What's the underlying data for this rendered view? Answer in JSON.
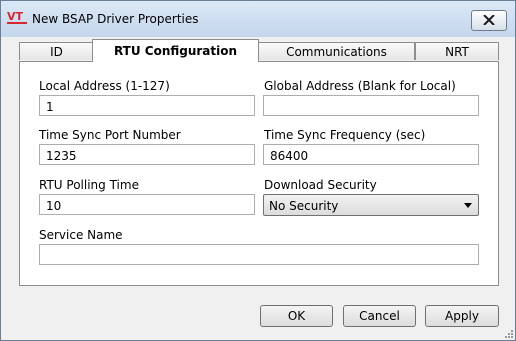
{
  "window": {
    "title": "New BSAP Driver Properties",
    "icon": "vt-logo-icon",
    "close_icon": "close-icon"
  },
  "tabs": [
    {
      "label": "ID",
      "active": false
    },
    {
      "label": "RTU Configuration",
      "active": true
    },
    {
      "label": "Communications",
      "active": false
    },
    {
      "label": "NRT",
      "active": false
    }
  ],
  "form": {
    "local_address": {
      "label": "Local Address (1-127)",
      "value": "1"
    },
    "global_address": {
      "label": "Global Address (Blank for Local)",
      "value": ""
    },
    "time_sync_port": {
      "label": "Time Sync Port Number",
      "value": "1235"
    },
    "time_sync_frequency": {
      "label": "Time Sync Frequency (sec)",
      "value": "86400"
    },
    "rtu_polling_time": {
      "label": "RTU Polling Time",
      "value": "10"
    },
    "download_security": {
      "label": "Download Security",
      "value": "No Security"
    },
    "service_name": {
      "label": "Service Name",
      "value": ""
    }
  },
  "buttons": {
    "ok": "OK",
    "cancel": "Cancel",
    "apply": "Apply"
  },
  "colors": {
    "title_bar": "#c4d6ec",
    "logo_red": "#d8262f"
  }
}
